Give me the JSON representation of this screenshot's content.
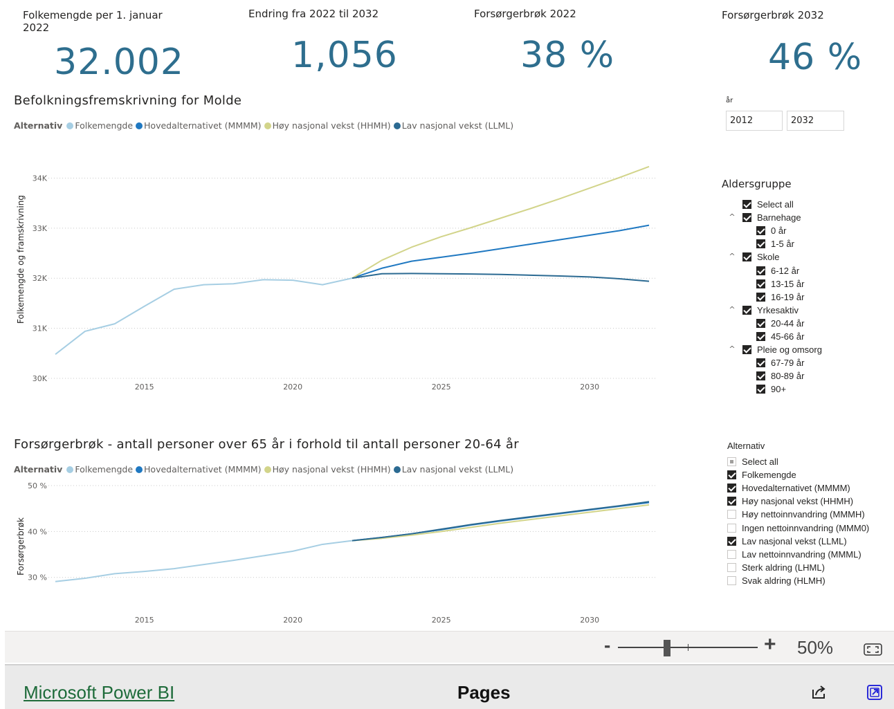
{
  "kpis": [
    {
      "title": "Folkemengde per 1. januar 2022",
      "value": "32.002"
    },
    {
      "title": "Endring fra 2022 til 2032",
      "value": "1,056"
    },
    {
      "title": "Forsørgerbrøk 2022",
      "value": "38 %"
    },
    {
      "title": "Forsørgerbrøk 2032",
      "value": "46 %"
    }
  ],
  "chart1": {
    "title": "Befolkningsfremskrivning for Molde",
    "ylabel": "Folkemengde og framskrivning"
  },
  "chart2": {
    "title": "Forsørgerbrøk - antall personer over 65 år i forhold til antall personer 20-64 år",
    "ylabel": "Forsørgerbrøk"
  },
  "legend": {
    "title": "Alternativ",
    "items": [
      {
        "label": "Folkemengde",
        "color": "#a6cee3"
      },
      {
        "label": "Hovedalternativet (MMMM)",
        "color": "#1f78c1"
      },
      {
        "label": "Høy nasjonal vekst (HHMH)",
        "color": "#d2d48a"
      },
      {
        "label": "Lav nasjonal vekst (LLML)",
        "color": "#2b6a92"
      }
    ]
  },
  "chart_data": [
    {
      "type": "line",
      "title": "Befolkningsfremskrivning for Molde",
      "ylabel": "Folkemengde og framskrivning",
      "xlabel": "",
      "xticks": [
        "2015",
        "2020",
        "2025",
        "2030"
      ],
      "yticks": [
        "30K",
        "31K",
        "32K",
        "33K",
        "34K"
      ],
      "xlim": [
        2012,
        2032
      ],
      "ylim": [
        30000,
        34200
      ],
      "grid": true,
      "series": [
        {
          "name": "Folkemengde",
          "color": "#a6cee3",
          "x": [
            2012,
            2013,
            2014,
            2015,
            2016,
            2017,
            2018,
            2019,
            2020,
            2021,
            2022
          ],
          "y": [
            30480,
            30940,
            31090,
            31440,
            31780,
            31870,
            31890,
            31970,
            31960,
            31870,
            32002
          ]
        },
        {
          "name": "Hovedalternativet (MMMM)",
          "color": "#1f78c1",
          "x": [
            2022,
            2023,
            2024,
            2025,
            2026,
            2027,
            2028,
            2029,
            2030,
            2031,
            2032
          ],
          "y": [
            32002,
            32200,
            32340,
            32420,
            32500,
            32590,
            32680,
            32770,
            32860,
            32950,
            33058
          ]
        },
        {
          "name": "Høy nasjonal vekst (HHMH)",
          "color": "#d2d48a",
          "x": [
            2022,
            2023,
            2024,
            2025,
            2026,
            2027,
            2028,
            2029,
            2030,
            2031,
            2032
          ],
          "y": [
            32002,
            32360,
            32620,
            32830,
            33010,
            33200,
            33390,
            33590,
            33800,
            34010,
            34230
          ]
        },
        {
          "name": "Lav nasjonal vekst (LLML)",
          "color": "#2b6a92",
          "x": [
            2022,
            2023,
            2024,
            2025,
            2026,
            2027,
            2028,
            2029,
            2030,
            2031,
            2032
          ],
          "y": [
            32002,
            32090,
            32095,
            32090,
            32085,
            32075,
            32060,
            32045,
            32025,
            31990,
            31940
          ]
        }
      ]
    },
    {
      "type": "line",
      "title": "Forsørgerbrøk - antall personer over 65 år i forhold til antall personer 20-64 år",
      "ylabel": "Forsørgerbrøk",
      "xlabel": "",
      "xticks": [
        "2015",
        "2020",
        "2025",
        "2030"
      ],
      "yticks": [
        "30 %",
        "40 %",
        "50 %"
      ],
      "xlim": [
        2012,
        2032
      ],
      "ylim": [
        0.28,
        0.5
      ],
      "grid": true,
      "series": [
        {
          "name": "Folkemengde",
          "color": "#a6cee3",
          "x": [
            2012,
            2013,
            2014,
            2015,
            2016,
            2017,
            2018,
            2019,
            2020,
            2021,
            2022
          ],
          "y": [
            0.291,
            0.298,
            0.308,
            0.313,
            0.319,
            0.328,
            0.337,
            0.347,
            0.357,
            0.372,
            0.38
          ]
        },
        {
          "name": "Hovedalternativet (MMMM)",
          "color": "#1f78c1",
          "x": [
            2022,
            2023,
            2024,
            2025,
            2026,
            2027,
            2028,
            2029,
            2030,
            2031,
            2032
          ],
          "y": [
            0.38,
            0.387,
            0.395,
            0.404,
            0.414,
            0.423,
            0.431,
            0.439,
            0.447,
            0.455,
            0.463
          ]
        },
        {
          "name": "Høy nasjonal vekst (HHMH)",
          "color": "#d2d48a",
          "x": [
            2022,
            2023,
            2024,
            2025,
            2026,
            2027,
            2028,
            2029,
            2030,
            2031,
            2032
          ],
          "y": [
            0.38,
            0.385,
            0.392,
            0.4,
            0.409,
            0.418,
            0.426,
            0.434,
            0.442,
            0.45,
            0.458
          ]
        },
        {
          "name": "Lav nasjonal vekst (LLML)",
          "color": "#2b6a92",
          "x": [
            2022,
            2023,
            2024,
            2025,
            2026,
            2027,
            2028,
            2029,
            2030,
            2031,
            2032
          ],
          "y": [
            0.38,
            0.387,
            0.395,
            0.405,
            0.415,
            0.424,
            0.432,
            0.44,
            0.448,
            0.456,
            0.465
          ]
        }
      ]
    }
  ],
  "year_slicer": {
    "label": "år",
    "from": "2012",
    "to": "2032"
  },
  "aldersgruppe": {
    "title": "Aldersgruppe",
    "items": [
      {
        "label": "Select all",
        "level": 0,
        "expandable": false
      },
      {
        "label": "Barnehage",
        "level": 0,
        "expandable": true
      },
      {
        "label": "0 år",
        "level": 1,
        "expandable": false
      },
      {
        "label": "1-5 år",
        "level": 1,
        "expandable": false
      },
      {
        "label": "Skole",
        "level": 0,
        "expandable": true
      },
      {
        "label": "6-12 år",
        "level": 1,
        "expandable": false
      },
      {
        "label": "13-15 år",
        "level": 1,
        "expandable": false
      },
      {
        "label": "16-19 år",
        "level": 1,
        "expandable": false
      },
      {
        "label": "Yrkesaktiv",
        "level": 0,
        "expandable": true
      },
      {
        "label": "20-44 år",
        "level": 1,
        "expandable": false
      },
      {
        "label": "45-66 år",
        "level": 1,
        "expandable": false
      },
      {
        "label": "Pleie og omsorg",
        "level": 0,
        "expandable": true
      },
      {
        "label": "67-79 år",
        "level": 1,
        "expandable": false
      },
      {
        "label": "80-89 år",
        "level": 1,
        "expandable": false
      },
      {
        "label": "90+",
        "level": 1,
        "expandable": false
      }
    ]
  },
  "alternativ_slicer": {
    "title": "Alternativ",
    "items": [
      {
        "label": "Select all",
        "state": "partial"
      },
      {
        "label": "Folkemengde",
        "state": "checked"
      },
      {
        "label": "Hovedalternativet (MMMM)",
        "state": "checked"
      },
      {
        "label": "Høy nasjonal vekst (HHMH)",
        "state": "checked"
      },
      {
        "label": "Høy nettoinnvandring (MMMH)",
        "state": "unchecked"
      },
      {
        "label": "Ingen nettoinnvandring (MMM0)",
        "state": "unchecked"
      },
      {
        "label": "Lav nasjonal vekst (LLML)",
        "state": "checked"
      },
      {
        "label": "Lav nettoinnvandring (MMML)",
        "state": "unchecked"
      },
      {
        "label": "Sterk aldring (LHML)",
        "state": "unchecked"
      },
      {
        "label": "Svak aldring (HLMH)",
        "state": "unchecked"
      }
    ]
  },
  "zoom": {
    "minus": "-",
    "plus": "+",
    "level": "50%",
    "slider_fraction": 0.35
  },
  "footer": {
    "brand": "Microsoft Power BI",
    "pages": "Pages"
  },
  "icons": {
    "share": "share-icon",
    "fit": "fit-to-page-icon",
    "popout": "open-in-new-icon"
  }
}
